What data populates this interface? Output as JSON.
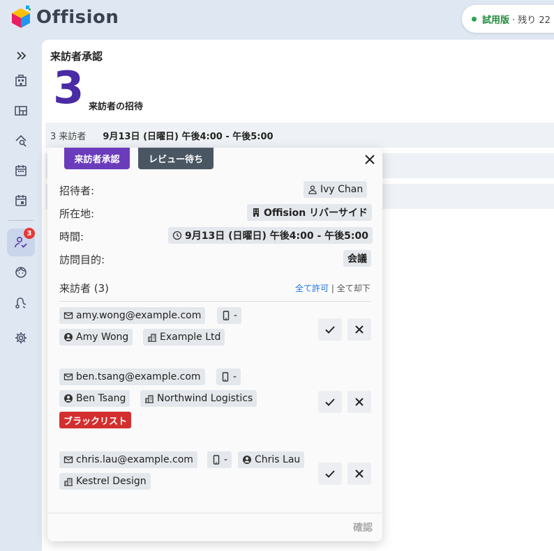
{
  "app": {
    "name": "Offision"
  },
  "trial": {
    "label": "試用版",
    "rest": "· 残り 22"
  },
  "sidebar": {
    "badge_count": "3"
  },
  "main": {
    "title": "来訪者承認",
    "big_count": "3",
    "big_label": "来訪者の招待",
    "rows": [
      {
        "count": "3 来訪者",
        "datetime": "9月13日 (日曜日) 午後4:00 - 午後5:00"
      }
    ]
  },
  "popup": {
    "approve_button": "来訪者承認",
    "review_button": "レビュー待ち",
    "fields": {
      "inviter_label": "招待者:",
      "inviter_value": "Ivy Chan",
      "location_label": "所在地:",
      "location_value": "Offision リバーサイド",
      "time_label": "時間:",
      "time_value": "9月13日 (日曜日) 午後4:00 - 午後5:00",
      "purpose_label": "訪問目的:",
      "purpose_value": "会議"
    },
    "visitors_heading": "来訪者 (3)",
    "allow_all": "全て許可",
    "separator": "|",
    "reject_all": "全て却下",
    "visitors": [
      {
        "email": "amy.wong@example.com",
        "phone": "-",
        "name": "Amy Wong",
        "company": "Example Ltd"
      },
      {
        "email": "ben.tsang@example.com",
        "phone": "-",
        "name": "Ben Tsang",
        "company": "Northwind Logistics",
        "tag": "ブラックリスト"
      },
      {
        "email": "chris.lau@example.com",
        "phone": "-",
        "name": "Chris Lau",
        "company": "Kestrel Design"
      }
    ],
    "confirm": "確認"
  },
  "colors": {
    "accent": "#6a3cbc",
    "big_number": "#4a2aa5",
    "blacklist": "#d32f2f",
    "trial_green": "#1f8a3a"
  }
}
